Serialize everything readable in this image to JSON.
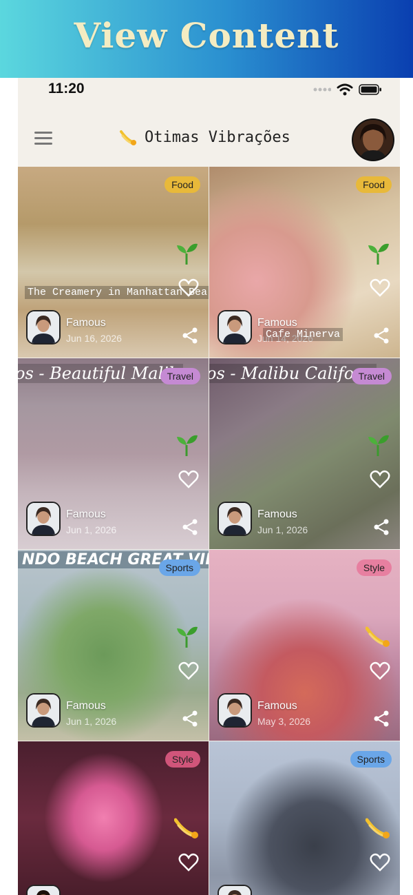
{
  "banner": {
    "title": "View Content"
  },
  "status": {
    "time": "11:20"
  },
  "app": {
    "title": "Otimas Vibrações",
    "logo_icon": "comet-icon"
  },
  "posts": [
    {
      "category": "Food",
      "category_color": "#e8b93a",
      "author": "Famous",
      "date": "Jun 16, 2026",
      "caption": "The Creamery in Manhattan Bea",
      "icon": "sprout-icon"
    },
    {
      "category": "Food",
      "category_color": "#e8b93a",
      "author": "Famous",
      "date": "Jun 14, 2026",
      "caption": "Cafe Minerva",
      "icon": "sprout-icon"
    },
    {
      "category": "Travel",
      "category_color": "#c58ad3",
      "author": "Famous",
      "date": "Jun 1, 2026",
      "caption": "os - Beautiful Malib",
      "icon": "sprout-icon"
    },
    {
      "category": "Travel",
      "category_color": "#c58ad3",
      "author": "Famous",
      "date": "Jun 1, 2026",
      "caption": "os - Malibu Californ",
      "icon": "sprout-icon"
    },
    {
      "category": "Sports",
      "category_color": "#6aa6e8",
      "author": "Famous",
      "date": "Jun 1, 2026",
      "caption": "NDO BEACH GREAT VIBES",
      "icon": "sprout-icon"
    },
    {
      "category": "Style",
      "category_color": "#e77fa0",
      "author": "Famous",
      "date": "May 3, 2026",
      "caption": "",
      "icon": "comet-icon"
    },
    {
      "category": "Style",
      "category_color": "#e77fa0",
      "author": "",
      "date": "",
      "caption": "",
      "icon": "comet-icon"
    },
    {
      "category": "Sports",
      "category_color": "#6aa6e8",
      "author": "",
      "date": "",
      "caption": "",
      "icon": "comet-icon"
    }
  ]
}
